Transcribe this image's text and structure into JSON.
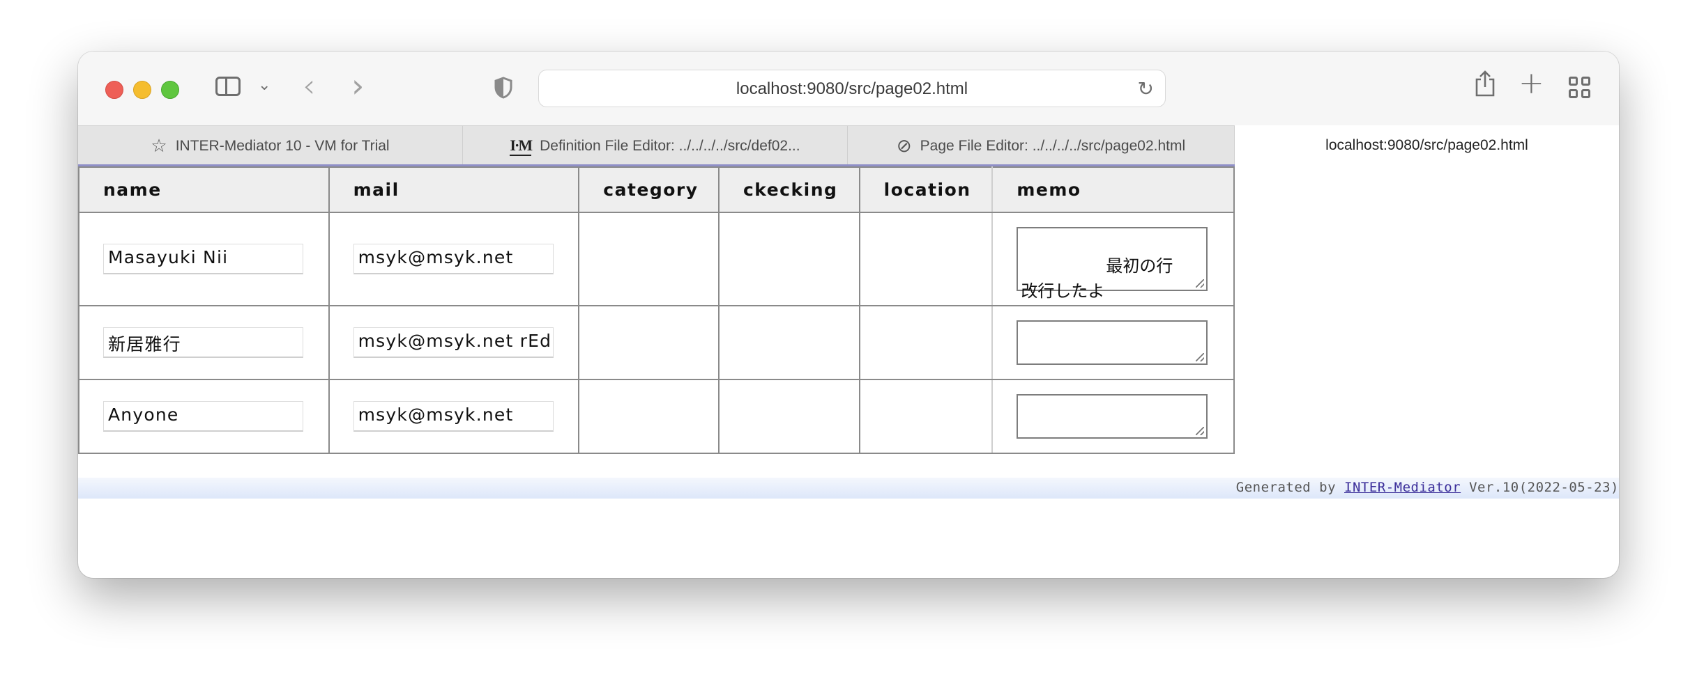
{
  "browser": {
    "url": "localhost:9080/src/page02.html",
    "icons": [
      "sidebar-icon",
      "chevron-down-icon",
      "back-icon",
      "forward-icon",
      "shield-icon",
      "reload-icon",
      "share-icon",
      "new-tab-icon",
      "tab-overview-icon"
    ],
    "tabs": [
      {
        "label": "INTER-Mediator 10 - VM for Trial",
        "icon": "star-icon"
      },
      {
        "label": "Definition File Editor: ../../../../src/def02...",
        "icon": "im-logo-icon"
      },
      {
        "label": "Page File Editor: ../../../../src/page02.html",
        "icon": "compass-icon"
      },
      {
        "label": "localhost:9080/src/page02.html",
        "icon": ""
      }
    ]
  },
  "table": {
    "headers": [
      "name",
      "mail",
      "category",
      "ckecking",
      "location",
      "memo"
    ],
    "rows": [
      {
        "name": "Masayuki Nii",
        "mail": "msyk@msyk.net",
        "category": "",
        "checking": "",
        "location": "",
        "memo": "最初の行\n改行したよ"
      },
      {
        "name": "新居雅行",
        "mail": "msyk@msyk.net rEd",
        "category": "",
        "checking": "",
        "location": "",
        "memo": ""
      },
      {
        "name": "Anyone",
        "mail": "msyk@msyk.net",
        "category": "",
        "checking": "",
        "location": "",
        "memo": ""
      }
    ]
  },
  "footer": {
    "prefix": "Generated by ",
    "link": "INTER-Mediator",
    "suffix": " Ver.10(2022-05-23)"
  },
  "colors": {
    "accent_line": "#8f8fc8",
    "footer_link": "#3b2e9a"
  }
}
